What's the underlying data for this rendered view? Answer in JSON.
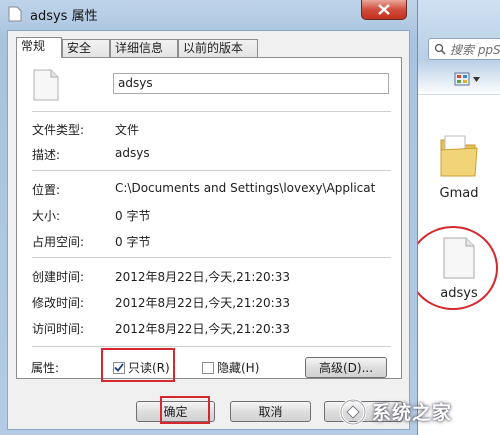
{
  "dialog": {
    "title": "adsys 属性",
    "tabs": [
      {
        "label": "常规",
        "active": true
      },
      {
        "label": "安全",
        "active": false
      },
      {
        "label": "详细信息",
        "active": false
      },
      {
        "label": "以前的版本",
        "active": false
      }
    ],
    "file_name": "adsys",
    "rows": {
      "type": {
        "label": "文件类型:",
        "value": "文件"
      },
      "desc": {
        "label": "描述:",
        "value": "adsys"
      },
      "location": {
        "label": "位置:",
        "value": "C:\\Documents and Settings\\lovexy\\Applicat"
      },
      "size": {
        "label": "大小:",
        "value": "0 字节"
      },
      "disk_size": {
        "label": "占用空间:",
        "value": "0 字节"
      },
      "created": {
        "label": "创建时间:",
        "value": "2012年8月22日,今天,21:20:33"
      },
      "modified": {
        "label": "修改时间:",
        "value": "2012年8月22日,今天,21:20:33"
      },
      "accessed": {
        "label": "访问时间:",
        "value": "2012年8月22日,今天,21:20:33"
      }
    },
    "attributes_label": "属性:",
    "readonly": {
      "label": "只读(R)",
      "checked": true
    },
    "hidden": {
      "label": "隐藏(H)",
      "checked": false
    },
    "advanced_label": "高级(D)...",
    "ok_label": "确定",
    "cancel_label": "取消"
  },
  "explorer": {
    "search_placeholder": "搜索 ppStro",
    "items": [
      {
        "label": "Gmad",
        "icon": "folder-icon"
      },
      {
        "label": "adsys",
        "icon": "file-icon"
      }
    ]
  },
  "watermark": {
    "text": "系统之家"
  },
  "colors": {
    "highlight_red": "#d6282d",
    "titlebar": "#bfd4ea",
    "close": "#c1311f"
  }
}
